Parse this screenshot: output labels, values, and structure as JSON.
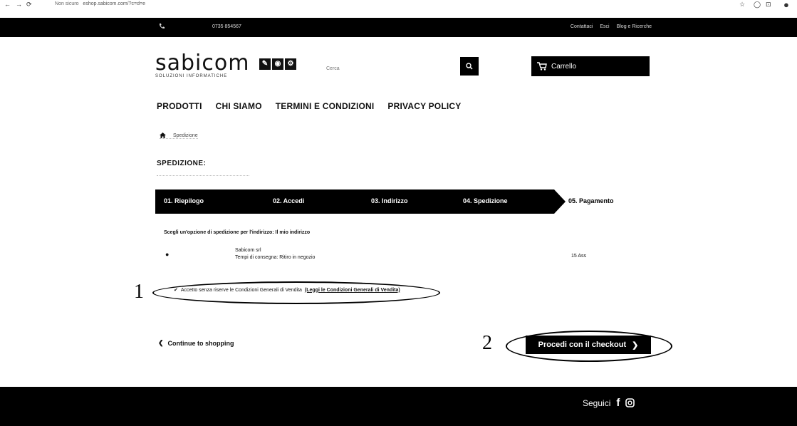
{
  "browser": {
    "security_label": "Non sicuro",
    "url": "eshop.sabicom.com/?c=d=e"
  },
  "topbar": {
    "phone": "0735 854567",
    "links": [
      "Contattaci",
      "Esci",
      "Blog e Ricerche"
    ]
  },
  "logo": {
    "name": "sabicom",
    "tagline": "SOLUZIONI INFORMATICHE"
  },
  "search": {
    "placeholder": "Cerca"
  },
  "cart": {
    "label": "Carrello"
  },
  "nav": [
    "PRODOTTI",
    "CHI SIAMO",
    "TERMINI E CONDIZIONI",
    "PRIVACY POLICY"
  ],
  "breadcrumb": {
    "current": "Spedizione"
  },
  "page_title": "SPEDIZIONE:",
  "steps": [
    "01. Riepilogo",
    "02. Accedi",
    "03. Indirizzo",
    "04. Spedizione",
    "05. Pagamento"
  ],
  "shipping": {
    "prompt": "Scegli un'opzione di spedizione per l'indirizzo: Il mio indirizzo",
    "carrier": "Sabicom srl",
    "delivery_time": "Tempi di consegna: Ritiro in negozio",
    "price": "15 Ass"
  },
  "terms": {
    "text": "Accetto senza riserve le Condizioni Generali di Vendita",
    "link": "(Leggi le Condizioni Generali di Vendita)"
  },
  "annotations": [
    "1",
    "2"
  ],
  "continue_label": "Continue to shopping",
  "checkout_label": "Procedi con il checkout",
  "footer": {
    "follow": "Seguici"
  },
  "icons": [
    "phone-icon",
    "search-icon",
    "cart-icon",
    "home-icon",
    "facebook-icon",
    "instagram-icon",
    "chevron-left-icon",
    "chevron-right-icon",
    "checkbox-icon"
  ]
}
